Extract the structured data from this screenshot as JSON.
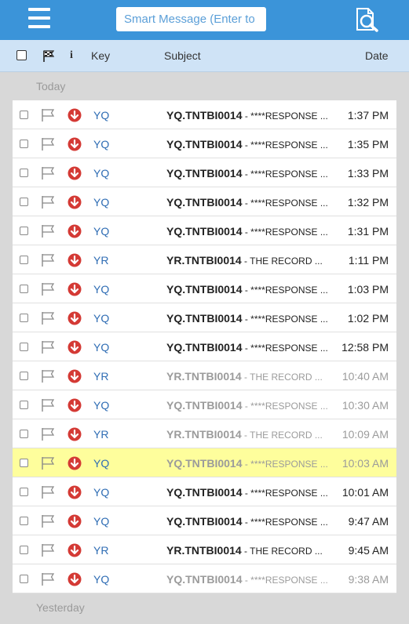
{
  "topbar": {
    "search_placeholder": "Smart Message (Enter to search)",
    "accent": "#3b94d9"
  },
  "columns": {
    "key": "Key",
    "subject": "Subject",
    "date": "Date",
    "info": "i"
  },
  "sections": {
    "today": "Today",
    "yesterday": "Yesterday"
  },
  "messages": [
    {
      "key": "YQ",
      "subject_id": "YQ.TNTBI0014",
      "subject_rest": " - ****RESPONSE ...",
      "date": "1:37 PM",
      "read": false,
      "highlight": false
    },
    {
      "key": "YQ",
      "subject_id": "YQ.TNTBI0014",
      "subject_rest": " - ****RESPONSE ...",
      "date": "1:35 PM",
      "read": false,
      "highlight": false
    },
    {
      "key": "YQ",
      "subject_id": "YQ.TNTBI0014",
      "subject_rest": " - ****RESPONSE ...",
      "date": "1:33 PM",
      "read": false,
      "highlight": false
    },
    {
      "key": "YQ",
      "subject_id": "YQ.TNTBI0014",
      "subject_rest": " - ****RESPONSE ...",
      "date": "1:32 PM",
      "read": false,
      "highlight": false
    },
    {
      "key": "YQ",
      "subject_id": "YQ.TNTBI0014",
      "subject_rest": " - ****RESPONSE ...",
      "date": "1:31 PM",
      "read": false,
      "highlight": false
    },
    {
      "key": "YR",
      "subject_id": "YR.TNTBI0014",
      "subject_rest": " - THE RECORD ...",
      "date": "1:11 PM",
      "read": false,
      "highlight": false
    },
    {
      "key": "YQ",
      "subject_id": "YQ.TNTBI0014",
      "subject_rest": " - ****RESPONSE ...",
      "date": "1:03 PM",
      "read": false,
      "highlight": false
    },
    {
      "key": "YQ",
      "subject_id": "YQ.TNTBI0014",
      "subject_rest": " - ****RESPONSE ...",
      "date": "1:02 PM",
      "read": false,
      "highlight": false
    },
    {
      "key": "YQ",
      "subject_id": "YQ.TNTBI0014",
      "subject_rest": " - ****RESPONSE ...",
      "date": "12:58 PM",
      "read": false,
      "highlight": false
    },
    {
      "key": "YR",
      "subject_id": "YR.TNTBI0014",
      "subject_rest": " - THE RECORD ...",
      "date": "10:40 AM",
      "read": true,
      "highlight": false
    },
    {
      "key": "YQ",
      "subject_id": "YQ.TNTBI0014",
      "subject_rest": " - ****RESPONSE ...",
      "date": "10:30 AM",
      "read": true,
      "highlight": false
    },
    {
      "key": "YR",
      "subject_id": "YR.TNTBI0014",
      "subject_rest": " - THE RECORD ...",
      "date": "10:09 AM",
      "read": true,
      "highlight": false
    },
    {
      "key": "YQ",
      "subject_id": "YQ.TNTBI0014",
      "subject_rest": " - ****RESPONSE ...",
      "date": "10:03 AM",
      "read": true,
      "highlight": true
    },
    {
      "key": "YQ",
      "subject_id": "YQ.TNTBI0014",
      "subject_rest": " - ****RESPONSE ...",
      "date": "10:01 AM",
      "read": false,
      "highlight": false
    },
    {
      "key": "YQ",
      "subject_id": "YQ.TNTBI0014",
      "subject_rest": " - ****RESPONSE ...",
      "date": "9:47 AM",
      "read": false,
      "highlight": false
    },
    {
      "key": "YR",
      "subject_id": "YR.TNTBI0014",
      "subject_rest": " - THE RECORD ...",
      "date": "9:45 AM",
      "read": false,
      "highlight": false
    },
    {
      "key": "YQ",
      "subject_id": "YQ.TNTBI0014",
      "subject_rest": " - ****RESPONSE ...",
      "date": "9:38 AM",
      "read": true,
      "highlight": false
    }
  ]
}
